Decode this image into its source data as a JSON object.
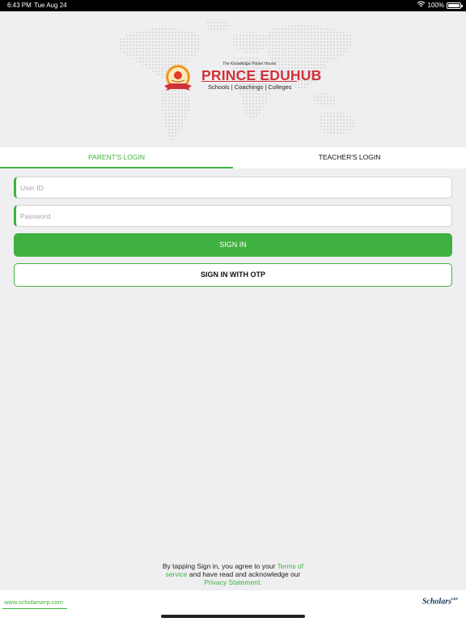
{
  "status_bar": {
    "time": "6:43 PM",
    "date": "Tue Aug 24",
    "battery": "100%",
    "battery_level": 1.0,
    "icons": [
      "wifi-icon",
      "battery-icon"
    ]
  },
  "brand": {
    "tagline": "The Knowledge Power House",
    "name": "PRINCE EDUHUB",
    "subtitle": "Schools | Coachings | Colleges",
    "color": "#d1323a"
  },
  "tabs": [
    {
      "label": "PARENT'S LOGIN",
      "active": true
    },
    {
      "label": "TEACHER'S LOGIN",
      "active": false
    }
  ],
  "form": {
    "user_id": {
      "placeholder": "User ID",
      "value": ""
    },
    "password": {
      "placeholder": "Password",
      "value": ""
    },
    "sign_in_label": "SIGN IN",
    "sign_in_otp_label": "SIGN IN WITH OTP"
  },
  "terms": {
    "prefix": "By tapping Sign in, you agree to your",
    "terms_link": "Terms of service",
    "middle": "and have read and acknowledge our",
    "privacy_link": "Privacy Statement.",
    "suffix": ""
  },
  "footer": {
    "url": "www.scholarserp.com",
    "brand": "Scholars",
    "brand_mark": "ERP"
  },
  "colors": {
    "accent": "#3eb33e",
    "background": "#efeff1",
    "brand_red": "#d1323a"
  }
}
